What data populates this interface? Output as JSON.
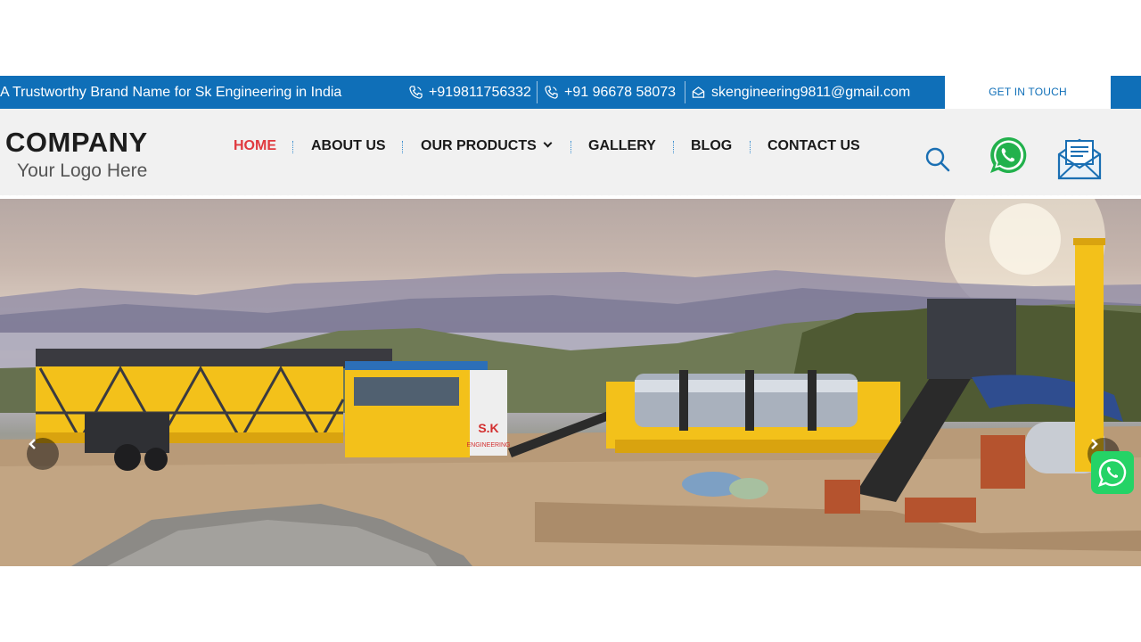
{
  "topbar": {
    "tagline": "A Trustworthy Brand Name for Sk Engineering in India",
    "phone1": "+919811756332",
    "phone2": "+91 96678 58073",
    "email": "skengineering9811@gmail.com",
    "cta_label": "GET IN TOUCH"
  },
  "logo": {
    "title": "COMPANY",
    "subtitle": "Your Logo Here"
  },
  "nav": {
    "items": [
      {
        "label": "HOME",
        "active": true
      },
      {
        "label": "ABOUT US"
      },
      {
        "label": "OUR PRODUCTS"
      },
      {
        "label": "GALLERY"
      },
      {
        "label": "BLOG"
      },
      {
        "label": "CONTACT US"
      }
    ]
  },
  "header_icons": [
    "search-icon",
    "whatsapp-icon",
    "mail-icon"
  ],
  "hero": {
    "cabin_label_1": "S.K",
    "cabin_label_2": "ENGINEERING",
    "prev_icon": "chevron-left-icon",
    "next_icon": "chevron-right-icon"
  },
  "colors": {
    "brand_blue": "#0f6fb8",
    "active_red": "#e0393e",
    "machine_yellow": "#f3c11a",
    "whatsapp_green": "#25d366"
  }
}
